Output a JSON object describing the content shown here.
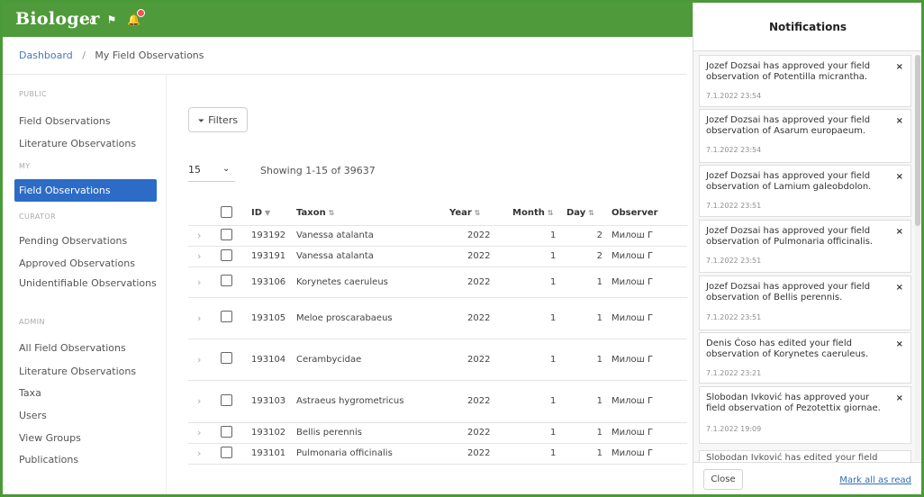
{
  "brand": {
    "name": "Biologer"
  },
  "breadcrumb": {
    "home": "Dashboard",
    "separator": "/",
    "current": "My Field Observations"
  },
  "sidebar": {
    "public_label": "PUBLIC",
    "my_label": "MY",
    "curator_label": "CURATOR",
    "admin_label": "ADMIN",
    "items": [
      "Field Observations",
      "Literature Observations",
      "Field Observations",
      "Pending Observations",
      "Approved Observations",
      "Unidentifiable Observations",
      "All Field Observations",
      "Literature Observations",
      "Taxa",
      "Users",
      "View Groups",
      "Publications"
    ]
  },
  "toolbar": {
    "filters": "Filters"
  },
  "pagination": {
    "per_page": "15",
    "showing": "Showing 1-15 of 39637"
  },
  "table": {
    "columns": [
      "ID",
      "Taxon",
      "Year",
      "Month",
      "Day",
      "Observer"
    ],
    "rows": [
      [
        "193192",
        "Vanessa atalanta",
        "2022",
        "1",
        "2",
        "Милош Г"
      ],
      [
        "193191",
        "Vanessa atalanta",
        "2022",
        "1",
        "2",
        "Милош Г"
      ],
      [
        "193106",
        "Korynetes caeruleus",
        "2022",
        "1",
        "1",
        "Милош Г"
      ],
      [
        "193105",
        "Meloe proscarabaeus",
        "2022",
        "1",
        "1",
        "Милош Г"
      ],
      [
        "193104",
        "Cerambycidae",
        "2022",
        "1",
        "1",
        "Милош Г"
      ],
      [
        "193103",
        "Astraeus hygrometricus",
        "2022",
        "1",
        "1",
        "Милош Г"
      ],
      [
        "193102",
        "Bellis perennis",
        "2022",
        "1",
        "1",
        "Милош Г"
      ],
      [
        "193101",
        "Pulmonaria officinalis",
        "2022",
        "1",
        "1",
        "Милош Г"
      ]
    ]
  },
  "notifications": {
    "title": "Notifications",
    "items": [
      {
        "text": "Jozef Dozsai has approved your field observation of Potentilla micrantha.",
        "time": "7.1.2022 23:54"
      },
      {
        "text": "Jozef Dozsai has approved your field observation of Asarum europaeum.",
        "time": "7.1.2022 23:54"
      },
      {
        "text": "Jozef Dozsai has approved your field observation of Lamium galeobdolon.",
        "time": "7.1.2022 23:51"
      },
      {
        "text": "Jozef Dozsai has approved your field observation of Pulmonaria officinalis.",
        "time": "7.1.2022 23:51"
      },
      {
        "text": "Jozef Dozsai has approved your field observation of Bellis perennis.",
        "time": "7.1.2022 23:51"
      },
      {
        "text": "Denis Ćoso has edited your field observation of Korynetes caeruleus.",
        "time": "7.1.2022 23:21"
      },
      {
        "text": "Slobodan Ivković has approved your field observation of Pezotettix giornae.",
        "time": "7.1.2022 19:09"
      },
      {
        "text": "Slobodan Ivković has edited your field",
        "time": ""
      }
    ],
    "close": "Close",
    "mark_all": "Mark all as read"
  },
  "colors": {
    "topbar": "#4f9a3a",
    "active": "#2c6cc7",
    "link": "#2f6fb4"
  }
}
